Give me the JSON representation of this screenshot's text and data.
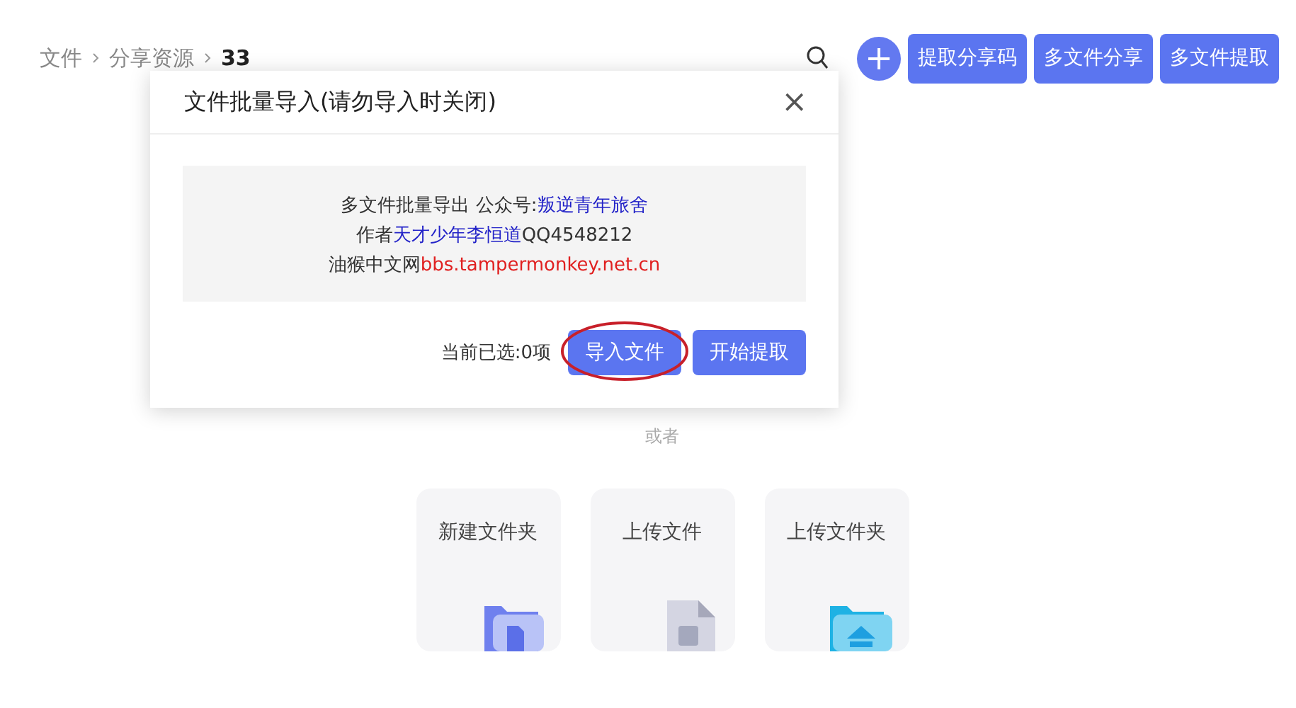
{
  "breadcrumb": [
    {
      "label": "文件"
    },
    {
      "label": "分享资源"
    },
    {
      "label": "33"
    }
  ],
  "toolbar": {
    "add_button": "+",
    "buttons": [
      "提取分享码",
      "多文件分享",
      "多文件提取"
    ]
  },
  "dialog": {
    "title": "文件批量导入(请勿导入时关闭)",
    "close": "×",
    "info_lines": [
      [
        {
          "text": "多文件批量导出 公众号:",
          "color": "#333333"
        },
        {
          "text": "叛逆青年旅舍",
          "color": "#2323c8"
        }
      ],
      [
        {
          "text": "作者",
          "color": "#333333"
        },
        {
          "text": "天才少年李恒道",
          "color": "#2323c8"
        },
        {
          "text": "QQ4548212",
          "color": "#333333"
        }
      ],
      [
        {
          "text": "油猴中文网",
          "color": "#333333"
        },
        {
          "text": "bbs.tampermonkey.net.cn",
          "color": "#e02020"
        }
      ]
    ],
    "selection_status": "当前已选:0项",
    "buttons": [
      {
        "label": "导入文件",
        "circled": true
      },
      {
        "label": "开始提取",
        "circled": false
      }
    ]
  },
  "separator_text": "或者",
  "cards": [
    {
      "label": "新建文件夹",
      "kind": "new-folder"
    },
    {
      "label": "上传文件",
      "kind": "upload-file"
    },
    {
      "label": "上传文件夹",
      "kind": "upload-folder"
    }
  ]
}
